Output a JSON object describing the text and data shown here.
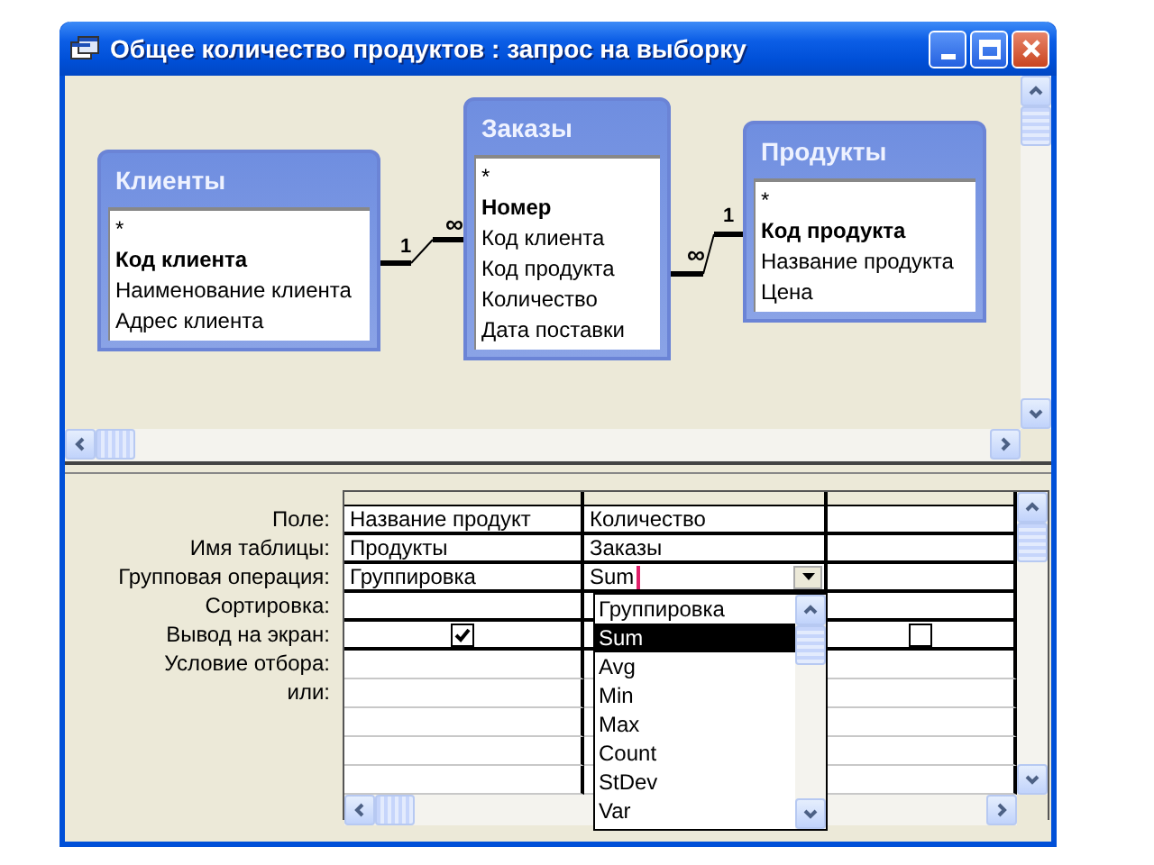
{
  "window": {
    "title": "Общее количество продуктов : запрос на выборку"
  },
  "tables": [
    {
      "title": "Клиенты",
      "fields": [
        {
          "name": "*",
          "key": false
        },
        {
          "name": "Код клиента",
          "key": true
        },
        {
          "name": "Наименование клиента",
          "key": false
        },
        {
          "name": "Адрес клиента",
          "key": false
        }
      ]
    },
    {
      "title": "Заказы",
      "fields": [
        {
          "name": "*",
          "key": false
        },
        {
          "name": "Номер",
          "key": true
        },
        {
          "name": "Код клиента",
          "key": false
        },
        {
          "name": "Код продукта",
          "key": false
        },
        {
          "name": "Количество",
          "key": false
        },
        {
          "name": "Дата поставки",
          "key": false
        }
      ]
    },
    {
      "title": "Продукты",
      "fields": [
        {
          "name": "*",
          "key": false
        },
        {
          "name": "Код продукта",
          "key": true
        },
        {
          "name": "Название продукта",
          "key": false
        },
        {
          "name": "Цена",
          "key": false
        }
      ]
    }
  ],
  "relationships": [
    {
      "one_label": "1",
      "many_label": "∞"
    },
    {
      "one_label": "1",
      "many_label": "∞"
    }
  ],
  "grid": {
    "row_labels": [
      "Поле:",
      "Имя таблицы:",
      "Групповая операция:",
      "Сортировка:",
      "Вывод на экран:",
      "Условие отбора:",
      "или:"
    ],
    "columns": [
      {
        "field": "Название продукт",
        "table": "Продукты",
        "total": "Группировка",
        "show": true,
        "editing": false
      },
      {
        "field": "Количество",
        "table": "Заказы",
        "total": "Sum",
        "editing": true
      },
      {
        "show": false,
        "editing": false
      }
    ]
  },
  "dropdown": {
    "options": [
      {
        "label": "Группировка",
        "selected": false
      },
      {
        "label": "Sum",
        "selected": true
      },
      {
        "label": "Avg",
        "selected": false
      },
      {
        "label": "Min",
        "selected": false
      },
      {
        "label": "Max",
        "selected": false
      },
      {
        "label": "Count",
        "selected": false
      },
      {
        "label": "StDev",
        "selected": false
      },
      {
        "label": "Var",
        "selected": false
      }
    ]
  }
}
